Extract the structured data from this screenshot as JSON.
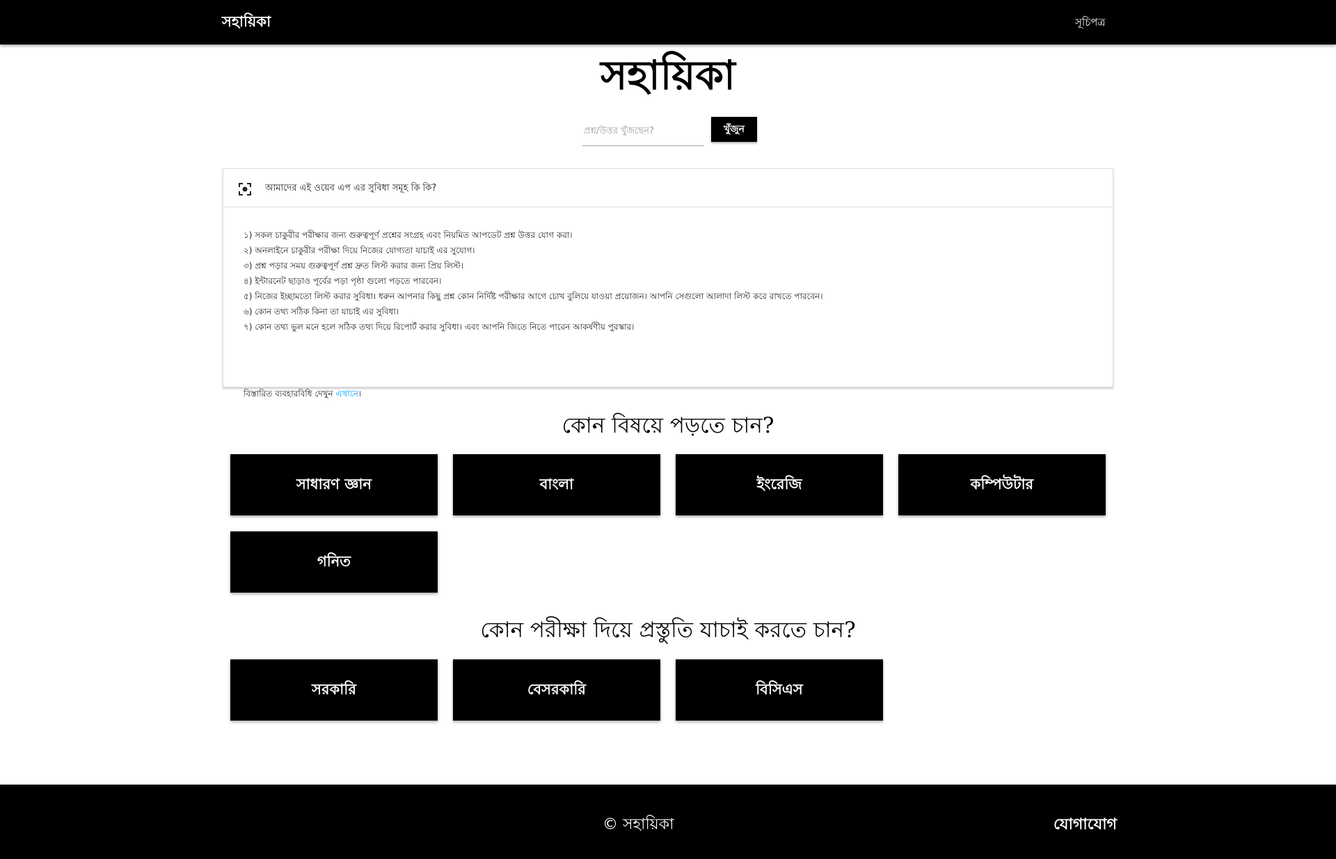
{
  "nav": {
    "brand": "সহায়িকা",
    "toc_link": "সূচিপত্র"
  },
  "hero": {
    "title": "সহায়িকা",
    "search_placeholder": "প্রশ্ন/উত্তর খুঁজছেন?",
    "search_value": "",
    "search_button": "খুঁজুন"
  },
  "features": {
    "icon": "center-focus-icon",
    "header": "আমাদের এই ওয়েব এপ এর সুবিধা সমূহ কি কি?",
    "items": [
      "১) সকল চাকুরীর পরীক্ষার জন্য গুরুত্বপূর্ণ প্রশ্নের সংগ্রহ এবং নিয়মিত আপডেট প্রশ্ন উত্তর যোগ করা।",
      "২) অনলাইনে চাকুরীর পরীক্ষা দিয়ে নিজের যোগ্যতা যাচাই এর সুযোগ।",
      "৩) প্রশ্ন পড়ার সময় গুরুত্বপূর্ণ প্রশ্ন দ্রুত লিস্ট করার জন্য প্রিয় লিস্ট।",
      "৪) ইন্টারনেট ছাড়াও পূর্বের পড়া পৃষ্ঠা গুলো পড়তে পারবেন।",
      "৫) নিজের ইচ্ছামতো লিস্ট করার সুবিধা। ধরুন আপনার কিছু প্রশ্ন কোন নির্দিষ্ট পরীক্ষার আগে চোখ বুলিয়ে যাওয়া প্রয়োজন। আপনি সেগুলো আলাদা লিস্ট করে রাখতে পারবেন।",
      "৬) কোন তথ্য সঠিক কিনা তা যাচাই এর সুবিধা।",
      "৭) কোন তথ্য ভুল মনে হলে সঠিক তথ্য দিয়ে রিপোর্ট করার সুবিধা। এবং আপনি জিতে নিতে পারেন আকর্ষণীয় পুরস্কার।"
    ],
    "details_prefix": "বিস্তারিত ব্যবহারবিধি দেখুন ",
    "details_link": "এখানে",
    "details_suffix": "।"
  },
  "subjects": {
    "title": "কোন বিষয়ে পড়তে চান?",
    "items": [
      "সাধারণ জ্ঞান",
      "বাংলা",
      "ইংরেজি",
      "কম্পিউটার",
      "গনিত"
    ]
  },
  "exams": {
    "title": "কোন পরীক্ষা দিয়ে প্রস্তুতি যাচাই করতে চান?",
    "items": [
      "সরকারি",
      "বেসরকারি",
      "বিসিএস"
    ]
  },
  "footer": {
    "copyright": "© সহায়িকা",
    "contact": "যোগাযোগ"
  }
}
